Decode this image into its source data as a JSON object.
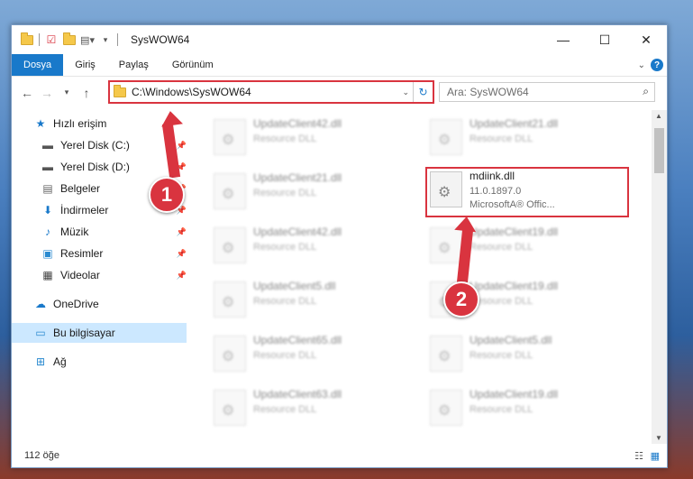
{
  "window": {
    "title": "SysWOW64"
  },
  "ribbon": {
    "tabs": [
      "Dosya",
      "Giriş",
      "Paylaş",
      "Görünüm"
    ]
  },
  "address": {
    "path": "C:\\Windows\\SysWOW64"
  },
  "search": {
    "placeholder": "Ara: SysWOW64"
  },
  "sidebar": {
    "items": [
      {
        "label": "Hızlı erişim",
        "icon": "star-icon"
      },
      {
        "label": "Yerel Disk (C:)",
        "icon": "drive-icon"
      },
      {
        "label": "Yerel Disk (D:)",
        "icon": "drive-icon"
      },
      {
        "label": "Belgeler",
        "icon": "documents-icon"
      },
      {
        "label": "İndirmeler",
        "icon": "download-icon"
      },
      {
        "label": "Müzik",
        "icon": "music-icon"
      },
      {
        "label": "Resimler",
        "icon": "pictures-icon"
      },
      {
        "label": "Videolar",
        "icon": "videos-icon"
      },
      {
        "label": "OneDrive",
        "icon": "cloud-icon"
      },
      {
        "label": "Bu bilgisayar",
        "icon": "computer-icon"
      },
      {
        "label": "Ağ",
        "icon": "network-icon"
      }
    ]
  },
  "files": {
    "left": [
      {
        "name": "UpdateClient42.dll",
        "type": "Resource DLL"
      },
      {
        "name": "UpdateClient21.dll",
        "type": "Resource DLL"
      },
      {
        "name": "UpdateClient42.dll",
        "type": "Resource DLL"
      },
      {
        "name": "UpdateClient5.dll",
        "type": "Resource DLL"
      },
      {
        "name": "UpdateClient65.dll",
        "type": "Resource DLL"
      },
      {
        "name": "UpdateClient63.dll",
        "type": "Resource DLL"
      }
    ],
    "right": [
      {
        "name": "UpdateClient21.dll",
        "type": "Resource DLL"
      },
      {
        "name": "UpdateClient19.dll",
        "type": "Resource DLL"
      },
      {
        "name": "UpdateClient19.dll",
        "type": "Resource DLL"
      },
      {
        "name": "UpdateClient5.dll",
        "type": "Resource DLL"
      },
      {
        "name": "UpdateClient19.dll",
        "type": "Resource DLL"
      }
    ],
    "highlighted": {
      "name": "mdiink.dll",
      "version": "11.0.1897.0",
      "company": "MicrosoftA® Offic..."
    }
  },
  "status": {
    "count": "112 öğe"
  },
  "annotations": {
    "step1": "1",
    "step2": "2"
  },
  "colors": {
    "accent": "#1979ca",
    "annotation": "#d9343f"
  }
}
